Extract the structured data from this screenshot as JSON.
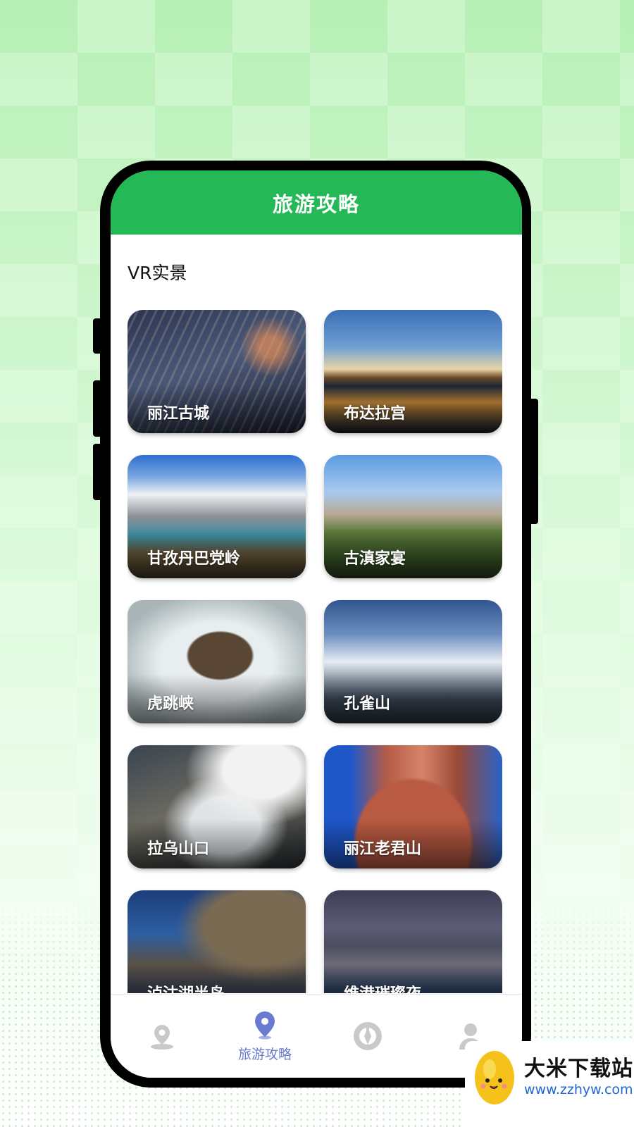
{
  "header": {
    "title": "旅游攻略"
  },
  "section": {
    "title": "VR实景"
  },
  "cards": [
    {
      "label": "丽江古城"
    },
    {
      "label": "布达拉宫"
    },
    {
      "label": "甘孜丹巴党岭"
    },
    {
      "label": "古滇家宴"
    },
    {
      "label": "虎跳峡"
    },
    {
      "label": "孔雀山"
    },
    {
      "label": "拉乌山口"
    },
    {
      "label": "丽江老君山"
    },
    {
      "label": "泸沽湖半岛"
    },
    {
      "label": "维港璀璨夜"
    }
  ],
  "tabbar": {
    "items": [
      {
        "icon": "location-pin-icon",
        "label": ""
      },
      {
        "icon": "map-pin-icon",
        "label": "旅游攻略",
        "active": true
      },
      {
        "icon": "compass-icon",
        "label": ""
      },
      {
        "icon": "user-icon",
        "label": ""
      }
    ],
    "active_color": "#6a7bcf",
    "inactive_color": "#c9c9c9"
  },
  "watermark": {
    "title": "大米下载站",
    "url": "www.zzhyw.com"
  },
  "colors": {
    "accent": "#25b857"
  }
}
